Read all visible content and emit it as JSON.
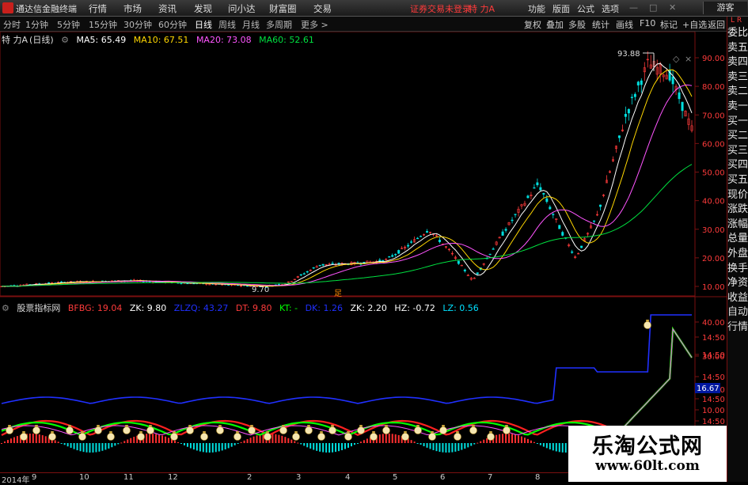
{
  "titlebar": {
    "app_name": "通达信金融终端",
    "menus": [
      "行情",
      "市场",
      "资讯",
      "发现",
      "问小达",
      "财富圈",
      "交易"
    ],
    "login_status": "证券交易未登录",
    "stock_title": "特 力A",
    "right_menus": [
      "功能",
      "版面",
      "公式",
      "选项"
    ],
    "guest": "游客"
  },
  "periodbar": {
    "periods": [
      "分时",
      "1分钟",
      "5分钟",
      "15分钟",
      "30分钟",
      "60分钟",
      "日线",
      "周线",
      "月线",
      "多周期",
      "更多 >"
    ],
    "active": "日线",
    "tools": [
      "复权",
      "叠加",
      "多股",
      "统计",
      "画线",
      "F10",
      "标记",
      "+自选",
      "返回"
    ]
  },
  "main_chart": {
    "stock": "特 力A",
    "period_tag": "(日线)",
    "ma": [
      {
        "label": "MA5: 65.49",
        "color": "#ffffff"
      },
      {
        "label": "MA10: 67.51",
        "color": "#ffd700"
      },
      {
        "label": "MA20: 73.08",
        "color": "#ff55ff"
      },
      {
        "label": "MA60: 52.61",
        "color": "#00e040"
      }
    ],
    "price_axis": [
      "90.00",
      "80.00",
      "70.00",
      "60.00",
      "50.00",
      "40.00",
      "30.00",
      "20.00",
      "10.00"
    ],
    "high_label": "93.88",
    "low_label": "9.70",
    "marker": "足"
  },
  "indicator": {
    "name": "股票指标网",
    "params": [
      {
        "label": "BFBG: 19.04",
        "color": "#ff3b3b"
      },
      {
        "label": "ZK: 9.80",
        "color": "#ffffff"
      },
      {
        "label": "ZLZQ: 43.27",
        "color": "#2030ff"
      },
      {
        "label": "DT: 9.80",
        "color": "#ff3b3b"
      },
      {
        "label": "KT: -",
        "color": "#00ff00"
      },
      {
        "label": "DK: 1.26",
        "color": "#2030ff"
      },
      {
        "label": "ZK: 2.20",
        "color": "#ffffff"
      },
      {
        "label": "HZ: -0.72",
        "color": "#ffffff"
      },
      {
        "label": "LZ: 0.56",
        "color": "#00e0ff"
      }
    ],
    "axis": [
      "40.00",
      "14:50",
      "14:50",
      "30.00",
      "14:50",
      "14:50",
      "14:50",
      "10.00",
      "14:50"
    ],
    "current_value": "16.67"
  },
  "right_panel": {
    "top_label": "L R",
    "items": [
      "委比",
      "卖五",
      "卖四",
      "卖三",
      "卖二",
      "卖一",
      "买一",
      "买二",
      "买三",
      "买四",
      "买五",
      "现价",
      "涨跌",
      "涨幅",
      "总量",
      "外盘",
      "换手",
      "净资",
      "收益",
      "自动",
      "行情"
    ]
  },
  "time_axis": [
    "2014年",
    "9",
    "10",
    "11",
    "12",
    "2",
    "3",
    "4",
    "5",
    "6",
    "7",
    "8"
  ],
  "watermark": {
    "title": "乐淘公式网",
    "url": "www.60lt.com"
  }
}
